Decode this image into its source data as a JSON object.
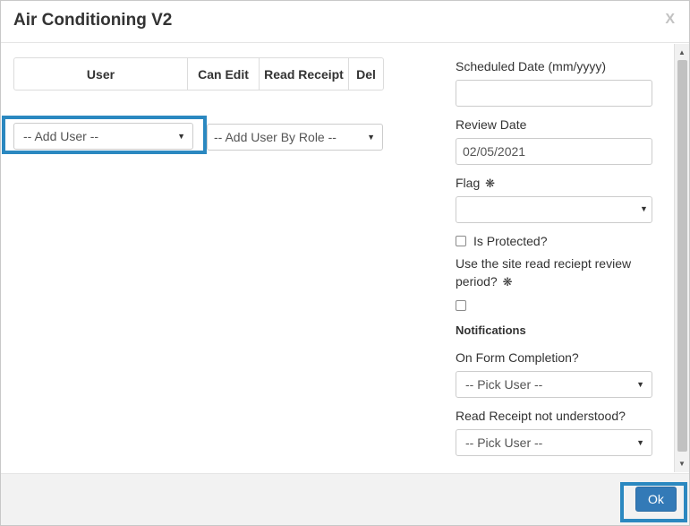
{
  "dialog": {
    "title": "Air Conditioning V2",
    "close_label": "X"
  },
  "users_table": {
    "headers": [
      "User",
      "Can Edit",
      "Read Receipt",
      "Del"
    ]
  },
  "add_user": {
    "selected": "-- Add User --"
  },
  "add_user_by_role": {
    "selected": "-- Add User By Role --"
  },
  "form": {
    "scheduled_date_label": "Scheduled Date (mm/yyyy)",
    "scheduled_date_value": "",
    "review_date_label": "Review Date",
    "review_date_value": "02/05/2021",
    "flag_label": "Flag",
    "flag_value": "",
    "is_protected_label": "Is Protected?",
    "is_protected_checked": false,
    "read_receipt_period_label_line1": "Use the site read reciept review",
    "read_receipt_period_label_line2": "period?",
    "read_receipt_period_checked": false,
    "notifications_heading": "Notifications",
    "on_form_completion_label": "On Form Completion?",
    "on_form_completion_value": "-- Pick User --",
    "read_receipt_not_understood_label": "Read Receipt not understood?",
    "read_receipt_not_understood_value": "-- Pick User --",
    "required_marker": "❋"
  },
  "footer": {
    "ok_label": "Ok"
  },
  "colors": {
    "primary": "#337ab7",
    "highlight": "#2b88c0"
  }
}
